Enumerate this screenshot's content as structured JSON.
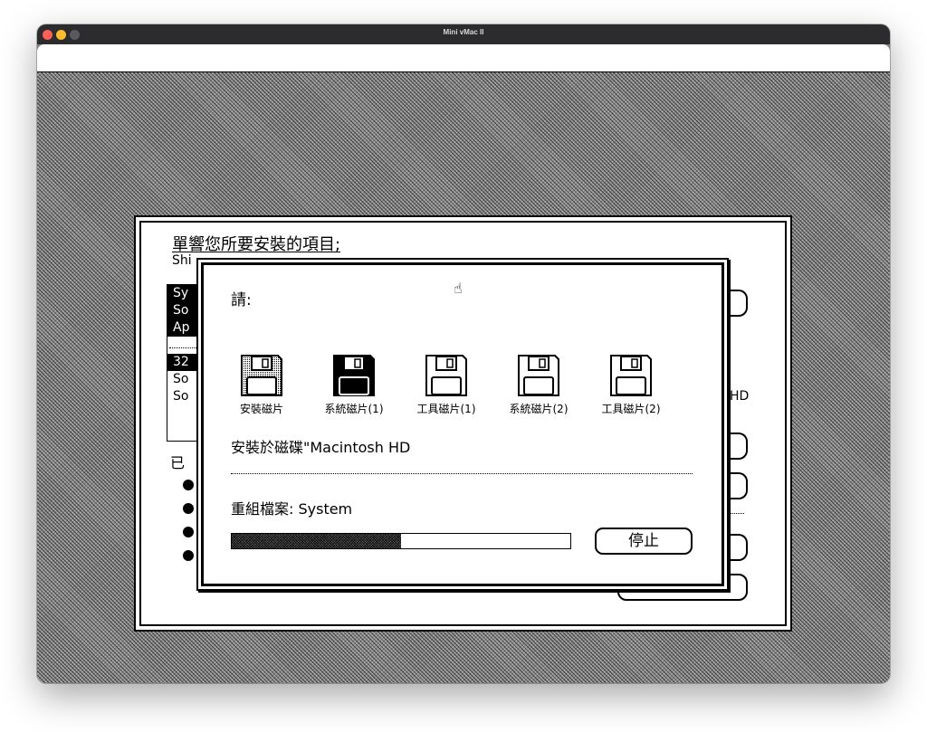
{
  "app": {
    "window_title": "Mini vMac II",
    "traffic_colors": [
      "#ff5f57",
      "#febc2e",
      "#5a5a5e"
    ]
  },
  "installer": {
    "heading": "單響您所要安裝的項目;",
    "subheading": "Shi",
    "list_items": [
      {
        "label": "Sy",
        "selected": true
      },
      {
        "label": "So",
        "selected": true
      },
      {
        "label": "Ap",
        "selected": true
      },
      {
        "label": "32",
        "selected": true
      },
      {
        "label": "So",
        "selected": false
      },
      {
        "label": "So",
        "selected": false
      }
    ],
    "installed_label": "已",
    "right_text": "HD"
  },
  "dialog": {
    "prompt": "請:",
    "disks": [
      {
        "label": "安裝磁片",
        "state": "done",
        "icon": "floppy-disk-icon"
      },
      {
        "label": "系統磁片(1)",
        "state": "active",
        "icon": "floppy-disk-icon"
      },
      {
        "label": "工具磁片(1)",
        "state": "pending",
        "icon": "floppy-disk-icon"
      },
      {
        "label": "系統磁片(2)",
        "state": "pending",
        "icon": "floppy-disk-icon"
      },
      {
        "label": "工具磁片(2)",
        "state": "pending",
        "icon": "floppy-disk-icon"
      }
    ],
    "destination": "安裝於磁碟\"Macintosh HD",
    "status": "重組檔案: System",
    "progress": 0.5,
    "stop_label": "停止"
  }
}
